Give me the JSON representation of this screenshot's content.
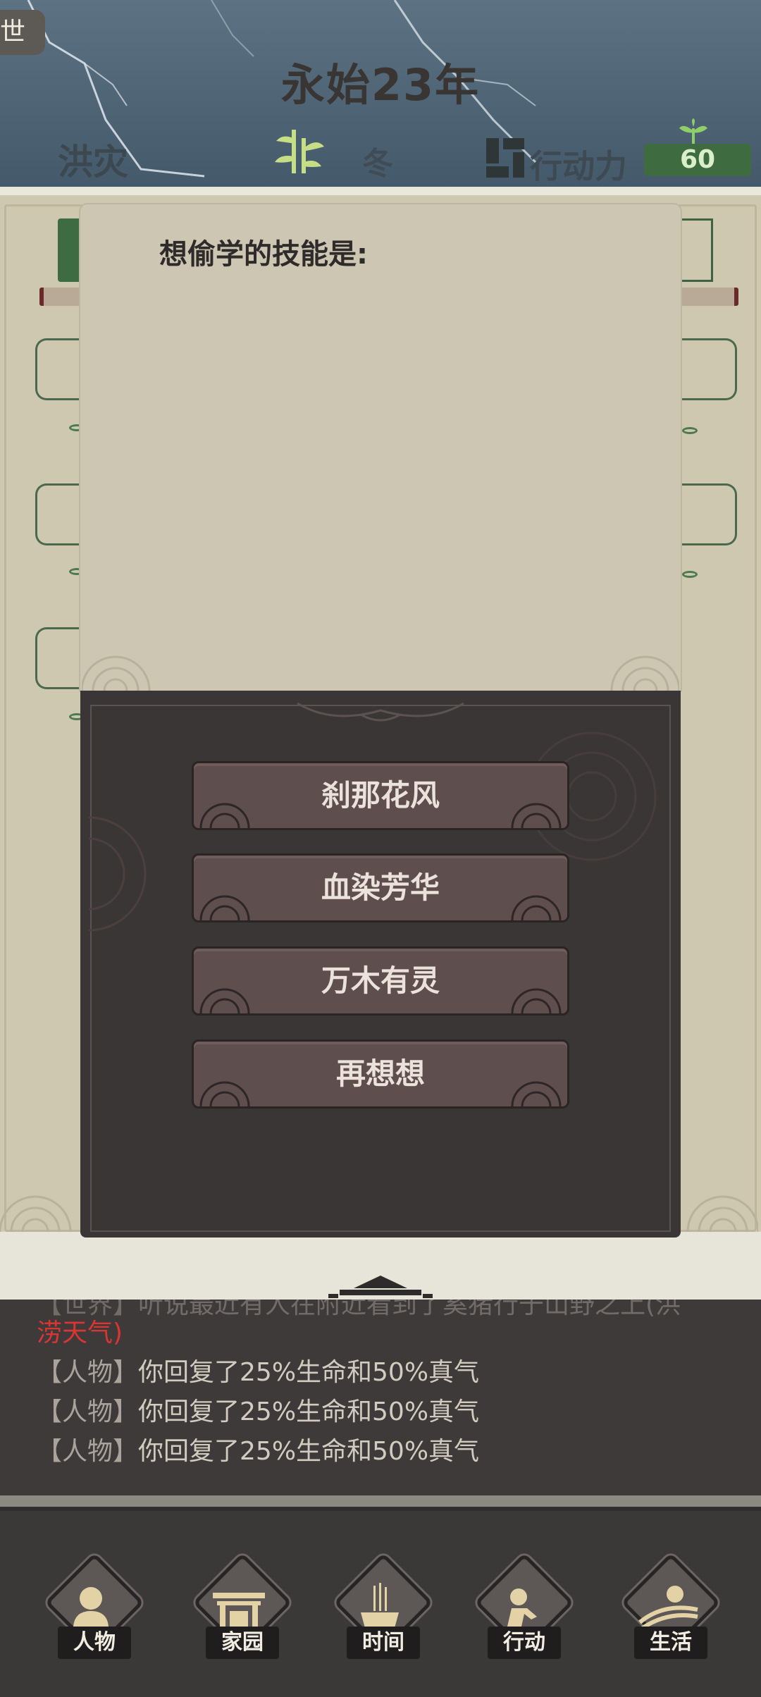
{
  "header": {
    "corner_tag": "世",
    "year": "永始23年",
    "weather": "洪灾",
    "season": "冬",
    "action_points_label": "行动力",
    "action_points_value": "60"
  },
  "modal": {
    "title": "想偷学的技能是:",
    "options": [
      {
        "label": "刹那花风"
      },
      {
        "label": "血染芳华"
      },
      {
        "label": "万木有灵"
      },
      {
        "label": "再想想"
      }
    ]
  },
  "log": {
    "partial_line": "【世界】听说最近有人在附近看到了奚猪行于山野之上(洪",
    "red_line": "涝天气)",
    "lines": [
      {
        "tag": "【人物】",
        "text": "你回复了25%生命和50%真气"
      },
      {
        "tag": "【人物】",
        "text": "你回复了25%生命和50%真气"
      },
      {
        "tag": "【人物】",
        "text": "你回复了25%生命和50%真气"
      }
    ]
  },
  "nav": {
    "items": [
      {
        "label": "人物",
        "icon": "person-icon"
      },
      {
        "label": "家园",
        "icon": "gate-icon"
      },
      {
        "label": "时间",
        "icon": "incense-icon"
      },
      {
        "label": "行动",
        "icon": "action-icon"
      },
      {
        "label": "生活",
        "icon": "landscape-icon"
      }
    ]
  },
  "colors": {
    "sky": "#4f6575",
    "panel": "#ccc6b2",
    "modal_dark": "#3b3636",
    "button": "#5f4e4e",
    "accent_green": "#3f6b41",
    "log_red": "#d93535"
  }
}
